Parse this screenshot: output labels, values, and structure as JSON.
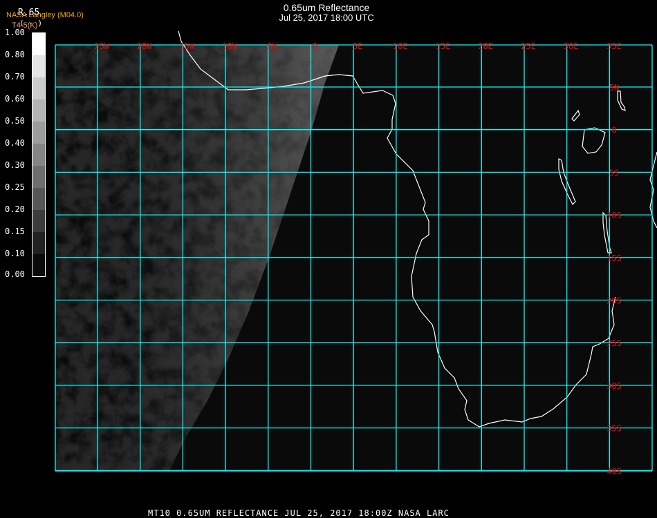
{
  "header": {
    "title": "0.65um Reflectance",
    "subtitle": "Jul 25, 2017 18:00 UTC",
    "variable": "R.65",
    "credit": "NASA Langley (M04.0)",
    "units": "( - )",
    "secondary": "T4-5(K)"
  },
  "colorbar": {
    "labels": [
      "1.00",
      "0.80",
      "0.70",
      "0.60",
      "0.50",
      "0.40",
      "0.30",
      "0.25",
      "0.20",
      "0.15",
      "0.10",
      "0.00"
    ],
    "colors": [
      "#ffffff",
      "#e4e4e4",
      "#cbcbcb",
      "#b4b4b4",
      "#9c9c9c",
      "#858585",
      "#6e6e6e",
      "#575757",
      "#3c3c3c",
      "#222222",
      "#0a0a0a"
    ]
  },
  "map": {
    "lon_labels": [
      "25W",
      "20W",
      "15W",
      "10W",
      "5W",
      "0",
      "5E",
      "10E",
      "15E",
      "20E",
      "25E",
      "30E",
      "35E"
    ],
    "lat_labels": [
      "5N",
      "0",
      "5S",
      "10S",
      "15S",
      "20S",
      "25S",
      "30S",
      "35S",
      "40S"
    ],
    "grid_color": "#00ffff",
    "label_color": "#ff0000",
    "coast_color": "#ffffff"
  },
  "footer": "MT10  0.65UM REFLECTANCE   JUL 25, 2017 18:00Z   NASA LARC"
}
